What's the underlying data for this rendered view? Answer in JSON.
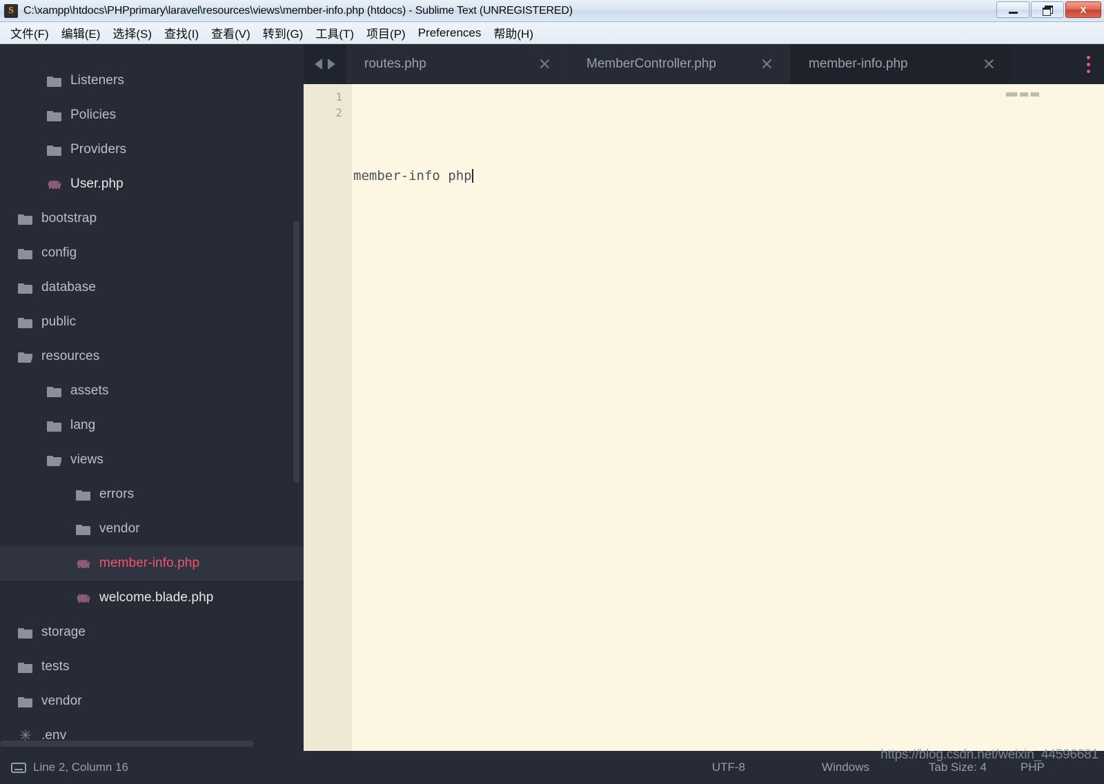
{
  "window": {
    "title": "C:\\xampp\\htdocs\\PHPprimary\\laravel\\resources\\views\\member-info.php (htdocs) - Sublime Text (UNREGISTERED)",
    "app_icon": "sublime-text-icon",
    "minimize_label": "",
    "restore_label": "",
    "close_label": "X"
  },
  "menubar": {
    "items": [
      {
        "label": "文件(F)",
        "name": "menu-file"
      },
      {
        "label": "编辑(E)",
        "name": "menu-edit"
      },
      {
        "label": "选择(S)",
        "name": "menu-selection"
      },
      {
        "label": "查找(I)",
        "name": "menu-find"
      },
      {
        "label": "查看(V)",
        "name": "menu-view"
      },
      {
        "label": "转到(G)",
        "name": "menu-goto"
      },
      {
        "label": "工具(T)",
        "name": "menu-tools"
      },
      {
        "label": "项目(P)",
        "name": "menu-project"
      },
      {
        "label": "Preferences",
        "name": "menu-preferences"
      },
      {
        "label": "帮助(H)",
        "name": "menu-help"
      }
    ]
  },
  "sidebar": {
    "items": [
      {
        "label": "Listeners",
        "icon": "folder",
        "depth": 2,
        "selected": false
      },
      {
        "label": "Policies",
        "icon": "folder",
        "depth": 2,
        "selected": false
      },
      {
        "label": "Providers",
        "icon": "folder",
        "depth": 2,
        "selected": false
      },
      {
        "label": "User.php",
        "icon": "php-file",
        "depth": 2,
        "selected": false
      },
      {
        "label": "bootstrap",
        "icon": "folder",
        "depth": 1,
        "selected": false
      },
      {
        "label": "config",
        "icon": "folder",
        "depth": 1,
        "selected": false
      },
      {
        "label": "database",
        "icon": "folder",
        "depth": 1,
        "selected": false
      },
      {
        "label": "public",
        "icon": "folder",
        "depth": 1,
        "selected": false
      },
      {
        "label": "resources",
        "icon": "folder-open",
        "depth": 1,
        "selected": false
      },
      {
        "label": "assets",
        "icon": "folder",
        "depth": 2,
        "selected": false
      },
      {
        "label": "lang",
        "icon": "folder",
        "depth": 2,
        "selected": false
      },
      {
        "label": "views",
        "icon": "folder-open",
        "depth": 2,
        "selected": false
      },
      {
        "label": "errors",
        "icon": "folder",
        "depth": 3,
        "selected": false
      },
      {
        "label": "vendor",
        "icon": "folder",
        "depth": 3,
        "selected": false
      },
      {
        "label": "member-info.php",
        "icon": "php-file",
        "depth": 3,
        "selected": true
      },
      {
        "label": "welcome.blade.php",
        "icon": "php-file",
        "depth": 3,
        "selected": false
      },
      {
        "label": "storage",
        "icon": "folder",
        "depth": 1,
        "selected": false
      },
      {
        "label": "tests",
        "icon": "folder",
        "depth": 1,
        "selected": false
      },
      {
        "label": "vendor",
        "icon": "folder",
        "depth": 1,
        "selected": false
      },
      {
        "label": ".env",
        "icon": "asterisk-file",
        "depth": 1,
        "selected": false
      }
    ]
  },
  "tabs": {
    "prev_label": "◀",
    "next_label": "▶",
    "close_label": "✕",
    "menu_label": "kebab-menu",
    "items": [
      {
        "label": "routes.php",
        "active": false
      },
      {
        "label": "MemberController.php",
        "active": false
      },
      {
        "label": "member-info.php",
        "active": true
      }
    ]
  },
  "editor": {
    "line_numbers": [
      "1",
      "2"
    ],
    "lines": [
      "",
      "member-info php"
    ],
    "caret_line": 2,
    "minimap_text": "member-info php"
  },
  "statusbar": {
    "cursor": "Line 2, Column 16",
    "encoding": "UTF-8",
    "line_endings": "Windows",
    "tab_size": "Tab Size: 4",
    "syntax": "PHP"
  },
  "watermark": "https://blog.csdn.net/weixin_44596681",
  "colors": {
    "sidebar_bg": "#272b35",
    "editor_bg": "#fdf6e3",
    "gutter_bg": "#eee8d5",
    "accent_red": "#f0556a",
    "tab_bar_bg": "#20242e",
    "active_tab_bg": "#1e222b"
  }
}
